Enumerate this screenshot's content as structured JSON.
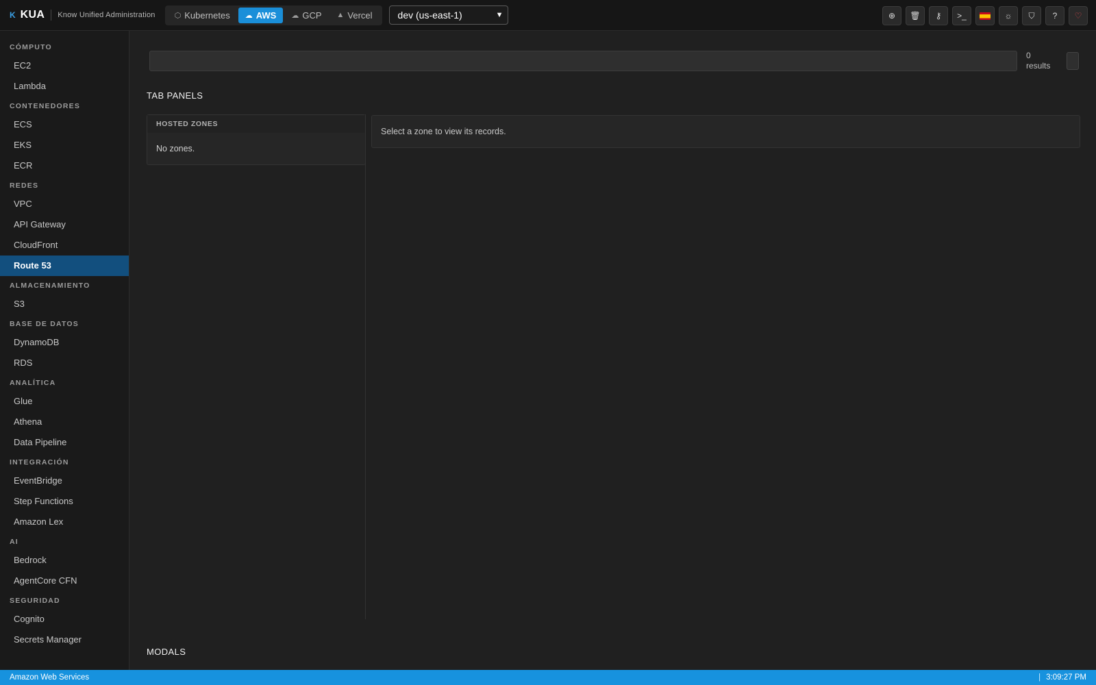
{
  "app": {
    "logo_mark": "K",
    "name": "KUA",
    "subtitle": "Know Unified Administration"
  },
  "providers": [
    {
      "label": "Kubernetes",
      "icon": "cube-icon",
      "glyph": "⬡",
      "active": false
    },
    {
      "label": "AWS",
      "icon": "cloud-icon",
      "glyph": "☁",
      "active": true
    },
    {
      "label": "GCP",
      "icon": "cloud-outline-icon",
      "glyph": "☁",
      "active": false
    },
    {
      "label": "Vercel",
      "icon": "triangle-icon",
      "glyph": "▲",
      "active": false
    }
  ],
  "environment": {
    "selected": "dev (us-east-1)"
  },
  "toolbar": [
    {
      "name": "add-icon",
      "glyph": "⊕"
    },
    {
      "name": "trash-icon",
      "glyph": "🗑"
    },
    {
      "name": "key-icon",
      "glyph": "⚷"
    },
    {
      "name": "terminal-icon",
      "glyph": ">_"
    },
    {
      "name": "spain-flag-icon",
      "glyph": ""
    },
    {
      "name": "sun-icon",
      "glyph": "☼"
    },
    {
      "name": "shield-icon",
      "glyph": "⛉"
    },
    {
      "name": "help-icon",
      "glyph": "?"
    },
    {
      "name": "heart-icon",
      "glyph": "♡"
    }
  ],
  "sidebar": {
    "sections": [
      {
        "title": "CÓMPUTO",
        "items": [
          "EC2",
          "Lambda"
        ]
      },
      {
        "title": "CONTENEDORES",
        "items": [
          "ECS",
          "EKS",
          "ECR"
        ]
      },
      {
        "title": "REDES",
        "items": [
          "VPC",
          "API Gateway",
          "CloudFront",
          "Route 53"
        ]
      },
      {
        "title": "ALMACENAMIENTO",
        "items": [
          "S3"
        ]
      },
      {
        "title": "BASE DE DATOS",
        "items": [
          "DynamoDB",
          "RDS"
        ]
      },
      {
        "title": "ANALÍTICA",
        "items": [
          "Glue",
          "Athena",
          "Data Pipeline"
        ]
      },
      {
        "title": "INTEGRACIÓN",
        "items": [
          "EventBridge",
          "Step Functions",
          "Amazon Lex"
        ]
      },
      {
        "title": "AI",
        "items": [
          "Bedrock",
          "AgentCore CFN"
        ]
      },
      {
        "title": "SEGURIDAD",
        "items": [
          "Cognito",
          "Secrets Manager"
        ]
      }
    ],
    "active_item": "Route 53"
  },
  "search": {
    "value": "",
    "results_count": "0",
    "results_label": "results"
  },
  "main": {
    "tab_panels_heading": "TAB PANELS",
    "zones_header": "HOSTED ZONES",
    "zones_empty": "No zones.",
    "records_empty": "Select a zone to view its records.",
    "modals_heading": "MODALS"
  },
  "statusbar": {
    "service": "Amazon Web Services",
    "time": "3:09:27 PM"
  },
  "colors": {
    "accent": "#1a8fd9",
    "active_nav": "#124f7e",
    "statusbar": "#1792de"
  }
}
